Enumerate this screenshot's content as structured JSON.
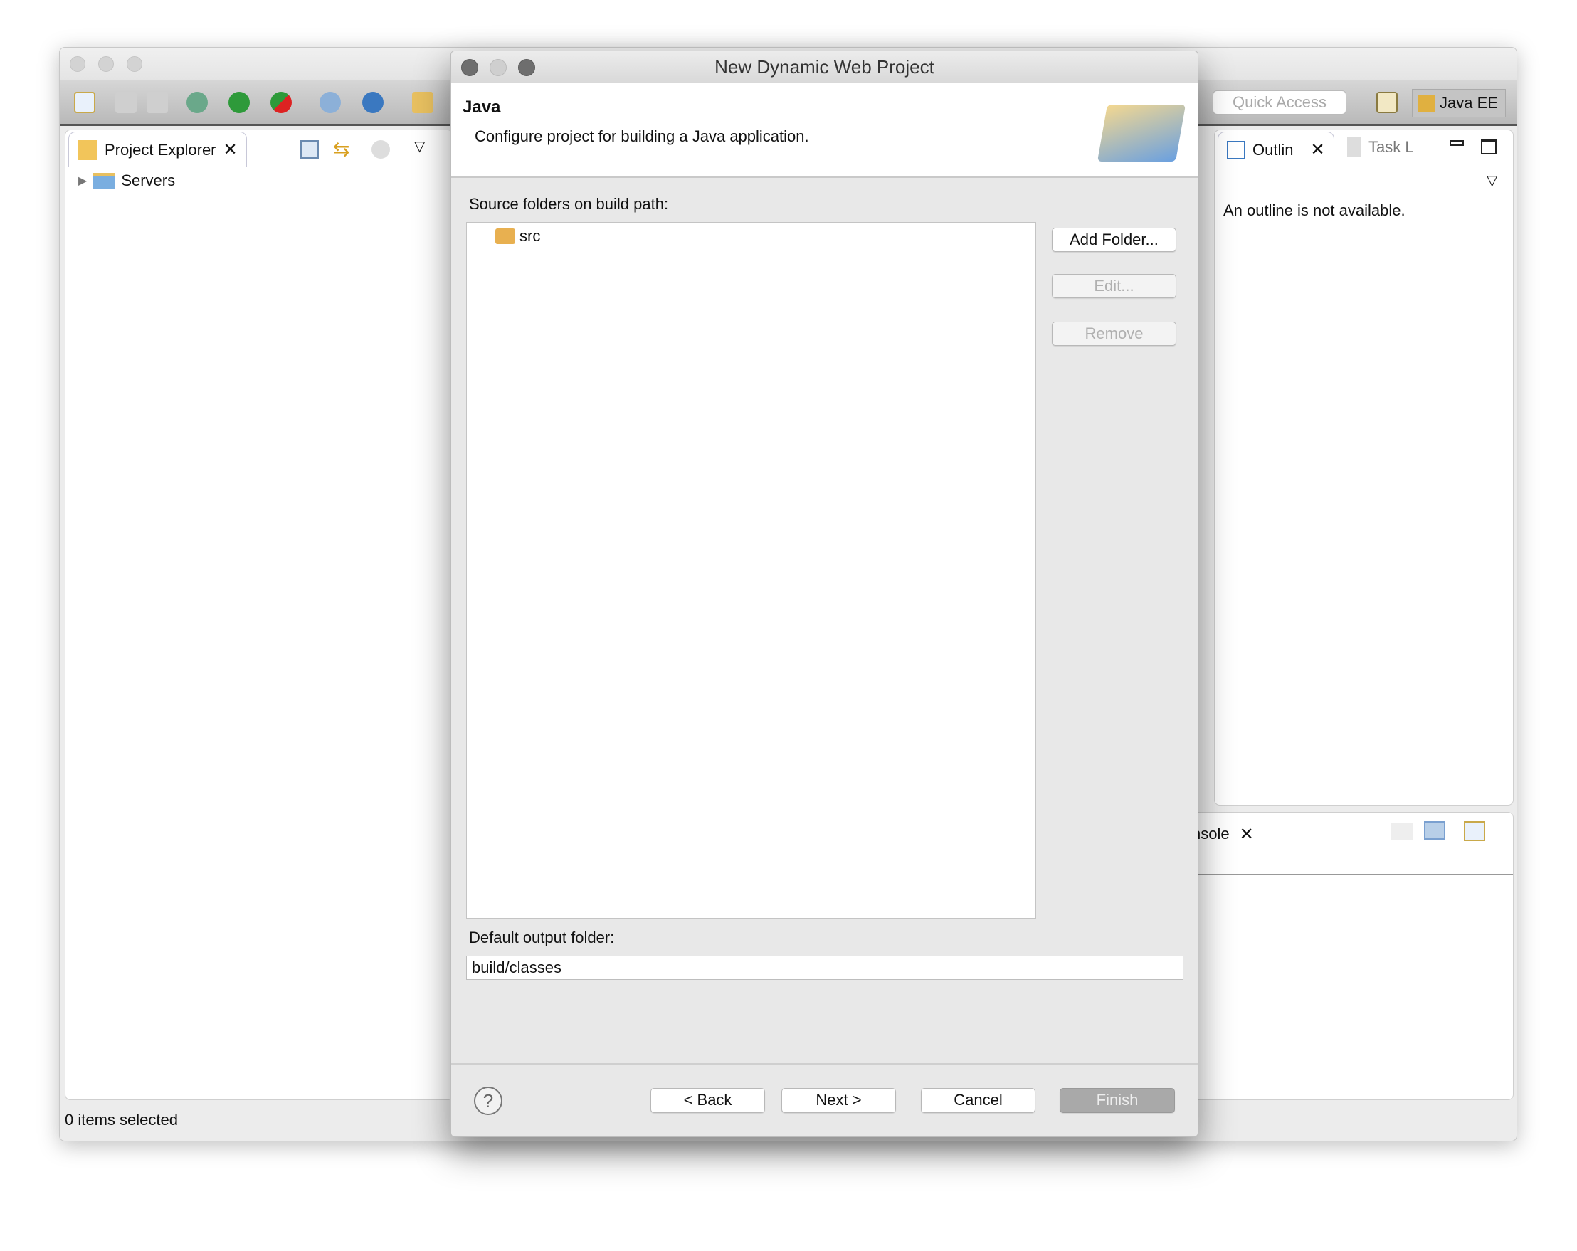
{
  "window": {
    "toolbar_icons": [
      "new-wizard-icon",
      "save-icon",
      "save-all-icon",
      "debug-icon",
      "run-icon",
      "run-server-icon",
      "new-server-icon",
      "new-service-icon",
      "open-project-icon"
    ],
    "quick_access_placeholder": "Quick Access",
    "perspective": "Java EE"
  },
  "project_explorer": {
    "tab": "Project Explorer",
    "tree": [
      {
        "label": "Servers"
      }
    ],
    "status": "0 items selected"
  },
  "outline": {
    "tab": "Outlin",
    "tab2": "Task L",
    "message": "An outline is not available."
  },
  "console": {
    "tab": "nsole"
  },
  "dialog": {
    "title": "New Dynamic Web Project",
    "heading": "Java",
    "description": "Configure project for building a Java application.",
    "source_label": "Source folders on build path:",
    "source_folders": [
      "src"
    ],
    "add_folder": "Add Folder...",
    "edit": "Edit...",
    "remove": "Remove",
    "output_label": "Default output folder:",
    "output_value": "build/classes",
    "back": "< Back",
    "next": "Next >",
    "cancel": "Cancel",
    "finish": "Finish",
    "help": "?"
  }
}
